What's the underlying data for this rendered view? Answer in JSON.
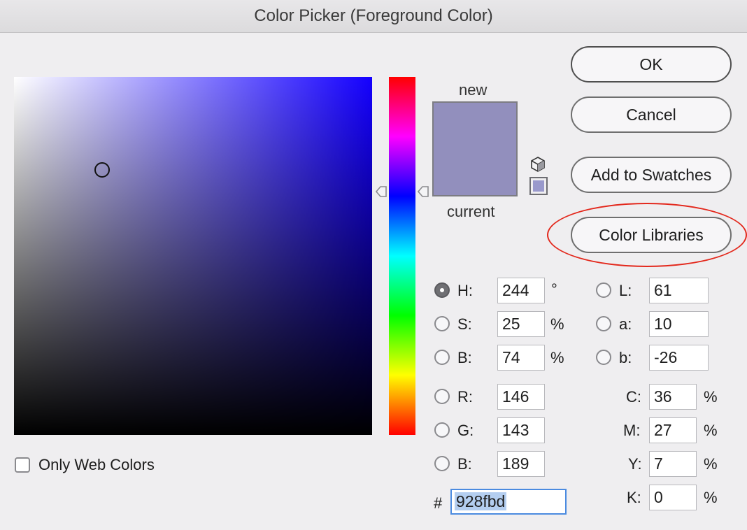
{
  "window": {
    "title": "Color Picker (Foreground Color)"
  },
  "preview": {
    "new_label": "new",
    "current_label": "current",
    "new_color": "#928fbd",
    "current_color": "#928fbd"
  },
  "buttons": {
    "ok": "OK",
    "cancel": "Cancel",
    "add_to_swatches": "Add to Swatches",
    "color_libraries": "Color Libraries"
  },
  "web_colors": {
    "label": "Only Web Colors",
    "checked": false
  },
  "hsb": {
    "h": {
      "label": "H:",
      "value": "244",
      "unit": "°",
      "selected": true
    },
    "s": {
      "label": "S:",
      "value": "25",
      "unit": "%",
      "selected": false
    },
    "b": {
      "label": "B:",
      "value": "74",
      "unit": "%",
      "selected": false
    }
  },
  "rgb": {
    "r": {
      "label": "R:",
      "value": "146",
      "selected": false
    },
    "g": {
      "label": "G:",
      "value": "143",
      "selected": false
    },
    "b": {
      "label": "B:",
      "value": "189",
      "selected": false
    }
  },
  "lab": {
    "l": {
      "label": "L:",
      "value": "61",
      "selected": false
    },
    "a": {
      "label": "a:",
      "value": "10",
      "selected": false
    },
    "b": {
      "label": "b:",
      "value": "-26",
      "selected": false
    }
  },
  "cmyk": {
    "c": {
      "label": "C:",
      "value": "36",
      "unit": "%"
    },
    "m": {
      "label": "M:",
      "value": "27",
      "unit": "%"
    },
    "y": {
      "label": "Y:",
      "value": "7",
      "unit": "%"
    },
    "k": {
      "label": "K:",
      "value": "0",
      "unit": "%"
    }
  },
  "hex": {
    "label": "#",
    "value": "928fbd"
  },
  "colors": {
    "highlight": "#e3281c",
    "hue_base": "#1400ff"
  }
}
